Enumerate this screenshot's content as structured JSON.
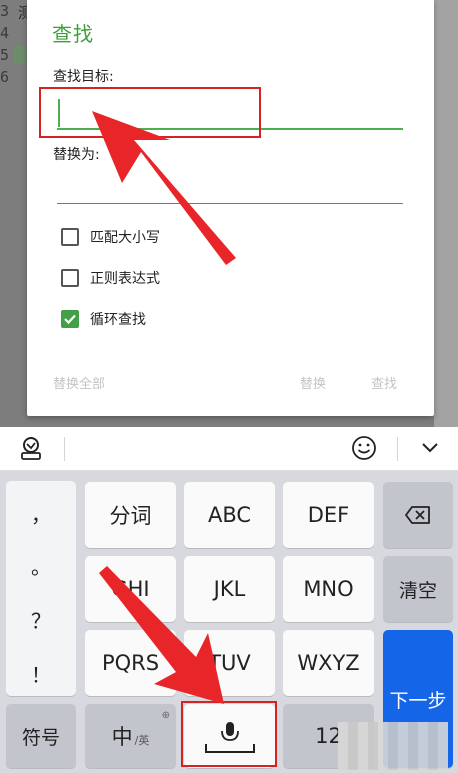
{
  "editor_bg": {
    "line_numbers": [
      "3",
      "4",
      "5",
      "6"
    ],
    "line_fragment": "测"
  },
  "dialog": {
    "title": "查找",
    "find_label": "查找目标:",
    "find_value": "",
    "replace_label": "替换为:",
    "replace_value": "",
    "options": [
      {
        "label": "匹配大小写",
        "checked": false
      },
      {
        "label": "正则表达式",
        "checked": false
      },
      {
        "label": "循环查找",
        "checked": true
      }
    ],
    "buttons": {
      "replace_all": "替换全部",
      "replace": "替换",
      "find": "查找"
    },
    "accent": "#3f9f3a"
  },
  "keyboard_toolbar": {
    "icons": [
      "keyboard-settings-icon",
      "emoji-icon",
      "collapse-chevron-icon"
    ]
  },
  "keyboard": {
    "punctuation": [
      "，",
      "。",
      "？",
      "！"
    ],
    "row1": [
      "分词",
      "ABC",
      "DEF"
    ],
    "row2": [
      "GHI",
      "JKL",
      "MNO"
    ],
    "row3": [
      "PQRS",
      "TUV",
      "WXYZ"
    ],
    "clear": "清空",
    "next": "下一步",
    "symbols": "符号",
    "lang_main": "中",
    "lang_sub": "/英",
    "numbers": "12",
    "primary_color": "#1565e9"
  }
}
